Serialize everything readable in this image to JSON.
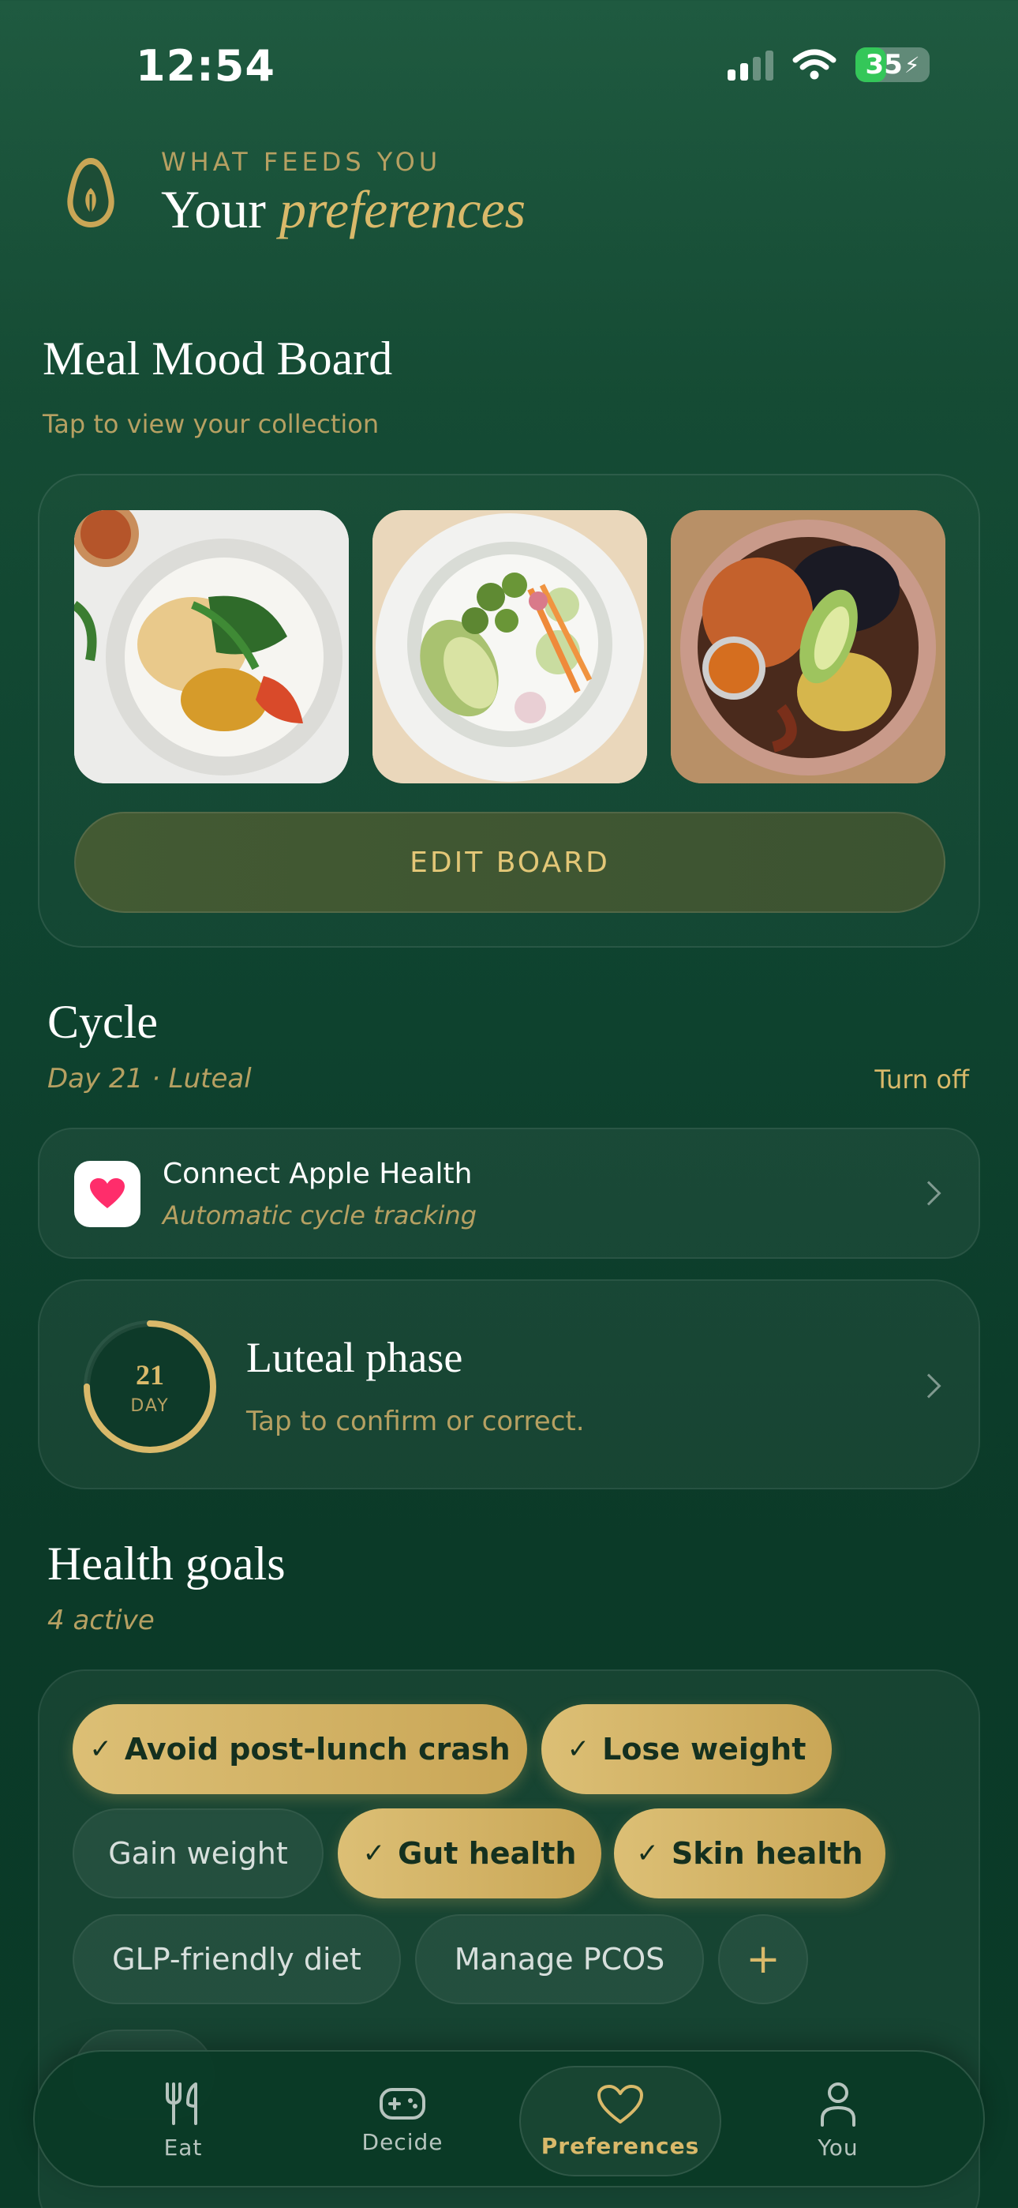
{
  "status": {
    "time": "12:54",
    "battery": "35"
  },
  "header": {
    "eyebrow": "WHAT FEEDS YOU",
    "title_plain": "Your",
    "title_italic": "preferences"
  },
  "mood_board": {
    "title": "Meal Mood Board",
    "subtitle": "Tap to view your collection",
    "edit_label": "EDIT BOARD"
  },
  "cycle": {
    "title": "Cycle",
    "status": "Day 21 · Luteal",
    "turn_off": "Turn off",
    "apple_health": {
      "title": "Connect Apple Health",
      "subtitle": "Automatic cycle tracking"
    },
    "phase": {
      "day_number": "21",
      "day_label": "DAY",
      "title": "Luteal phase",
      "subtitle": "Tap to confirm or correct.",
      "progress": 0.75
    }
  },
  "health_goals": {
    "title": "Health goals",
    "count": "4 active",
    "chips": [
      {
        "label": "Avoid post-lunch crash",
        "selected": true
      },
      {
        "label": "Lose weight",
        "selected": true
      },
      {
        "label": "Gain weight",
        "selected": false
      },
      {
        "label": "Gut health",
        "selected": true
      },
      {
        "label": "Skin health",
        "selected": true
      },
      {
        "label": "GLP-friendly diet",
        "selected": false
      },
      {
        "label": "Manage PCOS",
        "selected": false
      }
    ],
    "check": "✓",
    "add": "+"
  },
  "tabs": [
    {
      "label": "Eat",
      "icon": "fork-knife-icon"
    },
    {
      "label": "Decide",
      "icon": "gamepad-icon"
    },
    {
      "label": "Preferences",
      "icon": "heart-icon"
    },
    {
      "label": "You",
      "icon": "person-icon"
    }
  ],
  "colors": {
    "gold": "#d9b96a",
    "accent_green": "#34c759"
  }
}
